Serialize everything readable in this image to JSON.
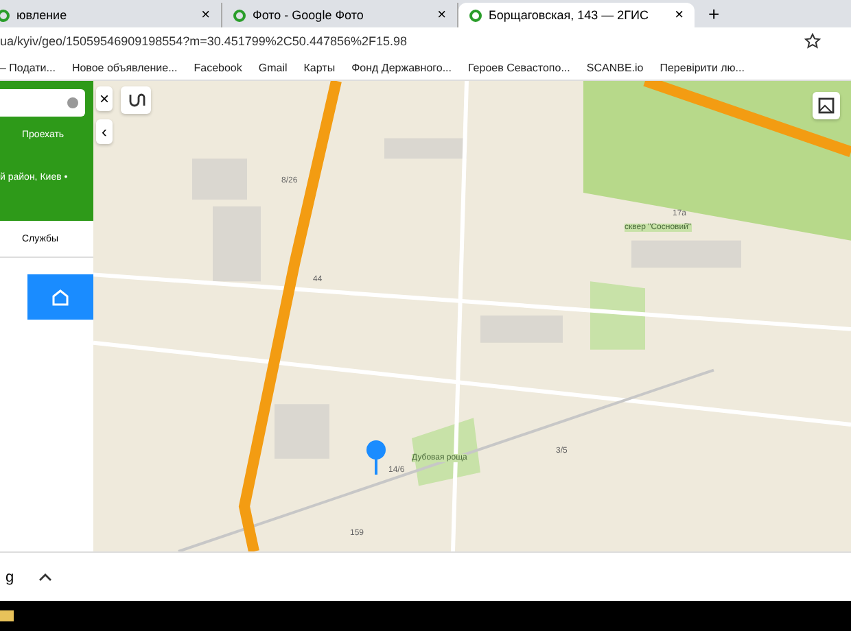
{
  "tabs": [
    {
      "title": "ювление",
      "selected": false,
      "close": "×"
    },
    {
      "title": "Фото - Google Фото",
      "selected": false,
      "close": "×"
    },
    {
      "title": "Борщаговская, 143 — 2ГИС",
      "selected": true,
      "close": "×"
    }
  ],
  "new_tab": "+",
  "address": "ua/kyiv/geo/15059546909198554?m=30.451799%2C50.447856%2F15.98",
  "bookmarks": [
    "– Подати...",
    "Новое объявление...",
    "Facebook",
    "Gmail",
    "Карты",
    "Фонд Державного...",
    "Героев Севастопо...",
    "SCANBE.io",
    "Перевірити лю..."
  ],
  "sidebar": {
    "search_close": "×",
    "collapse": "‹",
    "route_label": "Проехать",
    "location": "й район, Киев •",
    "tab": "Службы"
  },
  "map": {
    "labels": [
      {
        "text": "Дубовая роща",
        "kind": "place"
      },
      {
        "text": "сквер \"Сосновий\"",
        "kind": "place"
      },
      {
        "text": "14/6",
        "kind": "house"
      },
      {
        "text": "8/26",
        "kind": "house"
      },
      {
        "text": "44",
        "kind": "house"
      },
      {
        "text": "159",
        "kind": "house"
      },
      {
        "text": "3/5",
        "kind": "house"
      },
      {
        "text": "17а",
        "kind": "house"
      }
    ]
  },
  "download_bar": {
    "item": "g"
  }
}
